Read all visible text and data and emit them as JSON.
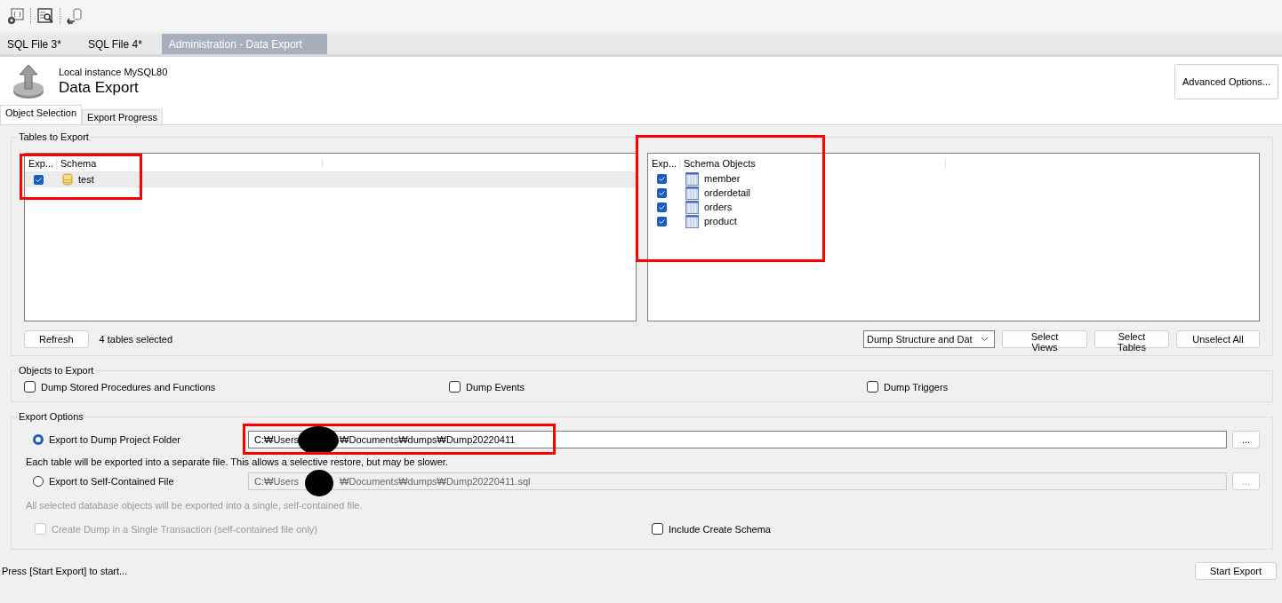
{
  "toolbar": {
    "icons": [
      {
        "kind": "function"
      },
      {
        "kind": "inspect"
      },
      {
        "kind": "database"
      }
    ]
  },
  "tabs": [
    {
      "label": "SQL File 3*",
      "selected": false,
      "closable": false
    },
    {
      "label": "SQL File 4*",
      "selected": false,
      "closable": false
    },
    {
      "label": "Administration - Data Export",
      "selected": true,
      "closable": true
    }
  ],
  "header": {
    "instance": "Local instance MySQL80",
    "title": "Data Export",
    "advanced_button": "Advanced Options..."
  },
  "subtabs": [
    {
      "label": "Object Selection",
      "selected": true
    },
    {
      "label": "Export Progress",
      "selected": false
    }
  ],
  "tables_to_export": {
    "title": "Tables to Export",
    "schemas": {
      "columns": [
        "Exp...",
        "Schema"
      ],
      "rows": [
        {
          "name": "test",
          "checked": true,
          "selected": true
        }
      ]
    },
    "objects": {
      "columns": [
        "Exp...",
        "Schema Objects"
      ],
      "rows": [
        {
          "name": "member",
          "checked": true
        },
        {
          "name": "orderdetail",
          "checked": true
        },
        {
          "name": "orders",
          "checked": true
        },
        {
          "name": "product",
          "checked": true
        }
      ]
    },
    "refresh_button": "Refresh",
    "status": "4 tables selected",
    "dump_select": "Dump Structure and Dat",
    "buttons": [
      "Select Views",
      "Select Tables",
      "Unselect All"
    ]
  },
  "objects_to_export": {
    "title": "Objects to Export",
    "options": [
      {
        "label": "Dump Stored Procedures and Functions",
        "checked": false
      },
      {
        "label": "Dump Events",
        "checked": false
      },
      {
        "label": "Dump Triggers",
        "checked": false
      }
    ]
  },
  "export_options": {
    "title": "Export Options",
    "targets": [
      {
        "label": "Export to Dump Project Folder",
        "selected": true,
        "path": {
          "before": "C:₩Users",
          "after": "₩Documents₩dumps₩Dump20220411",
          "redacted": true
        },
        "note": "Each table will be exported into a separate file. This allows a selective restore, but may be slower.",
        "browse": "..."
      },
      {
        "label": "Export to Self-Contained File",
        "selected": false,
        "path": {
          "before": "C:₩Users",
          "after": "₩Documents₩dumps₩Dump20220411.sql",
          "redacted": true
        },
        "note": "All selected database objects will be exported into a single, self-contained file.",
        "browse": "..."
      }
    ],
    "single_transaction": {
      "label": "Create Dump in a Single Transaction (self-contained file only)",
      "checked": false,
      "disabled": true
    },
    "include_schema": {
      "label": "Include Create Schema",
      "checked": false,
      "disabled": false
    }
  },
  "footer": {
    "status": "Press [Start Export] to start...",
    "start_button": "Start Export"
  },
  "annotations": [
    {
      "kind": "highlight"
    },
    {
      "kind": "highlight"
    },
    {
      "kind": "highlight"
    }
  ]
}
